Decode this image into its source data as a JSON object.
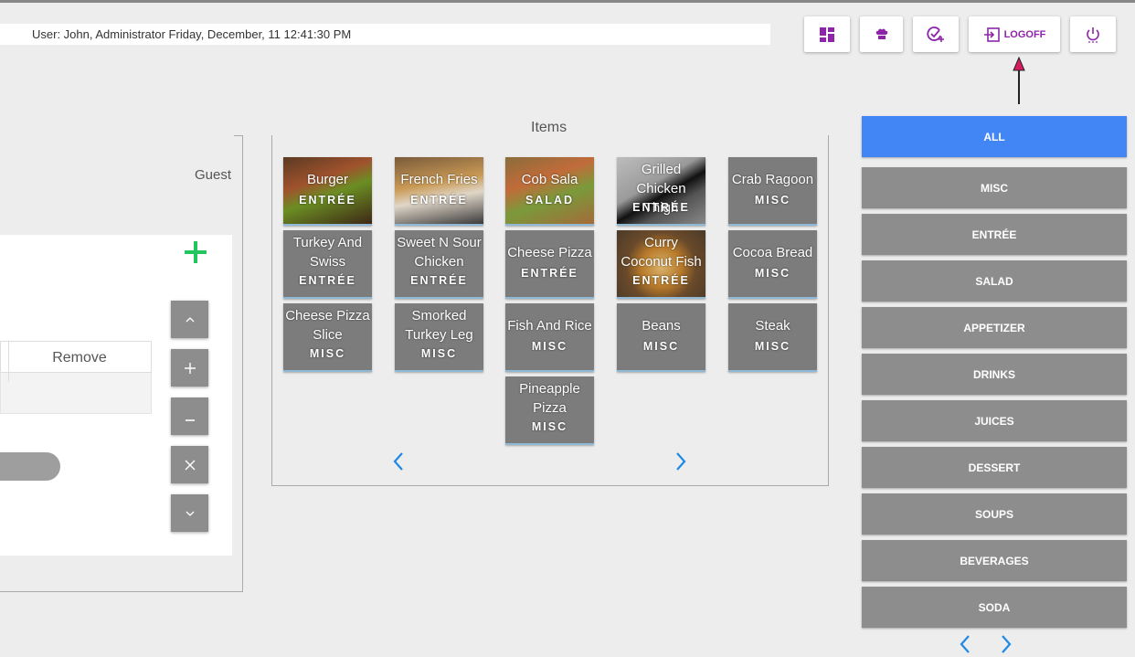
{
  "header": {
    "user_status": "User: John, Administrator Friday, December, 11 12:41:30 PM",
    "logoff_label": "LOGOFF"
  },
  "order": {
    "guest_label": "Guest",
    "table_remove_header": "Remove"
  },
  "items": {
    "title": "Items",
    "list": [
      {
        "name": "Burger",
        "category": "ENTRÉE"
      },
      {
        "name": "French Fries",
        "category": "ENTRÉE"
      },
      {
        "name": "Cob Sala",
        "category": "SALAD"
      },
      {
        "name": "Grilled Chicken Thigh",
        "category": "ENTRÉE"
      },
      {
        "name": "Crab Ragoon",
        "category": "MISC"
      },
      {
        "name": "Turkey And Swiss",
        "category": "ENTRÉE"
      },
      {
        "name": "Sweet N Sour Chicken",
        "category": "ENTRÉE"
      },
      {
        "name": "Cheese Pizza",
        "category": "ENTRÉE"
      },
      {
        "name": "Curry Coconut Fish",
        "category": "ENTRÉE"
      },
      {
        "name": "Cocoa Bread",
        "category": "MISC"
      },
      {
        "name": "Cheese Pizza Slice",
        "category": "MISC"
      },
      {
        "name": "Smorked Turkey Leg",
        "category": "MISC"
      },
      {
        "name": "Fish And Rice",
        "category": "MISC"
      },
      {
        "name": "Beans",
        "category": "MISC"
      },
      {
        "name": "Steak",
        "category": "MISC"
      },
      {
        "name": "Pineapple Pizza",
        "category": "MISC"
      }
    ]
  },
  "categories": {
    "list": [
      "ALL",
      "MISC",
      "ENTRÉE",
      "SALAD",
      "APPETIZER",
      "DRINKS",
      "JUICES",
      "DESSERT",
      "SOUPS",
      "BEVERAGES",
      "SODA"
    ],
    "active": "ALL"
  },
  "colors": {
    "accent_blue": "#4285f4",
    "toolbar_icon_purple": "#8e24aa",
    "add_green": "#22c55e",
    "pager_blue": "#1e88e5",
    "annotation_arrow": "#d81b60"
  }
}
